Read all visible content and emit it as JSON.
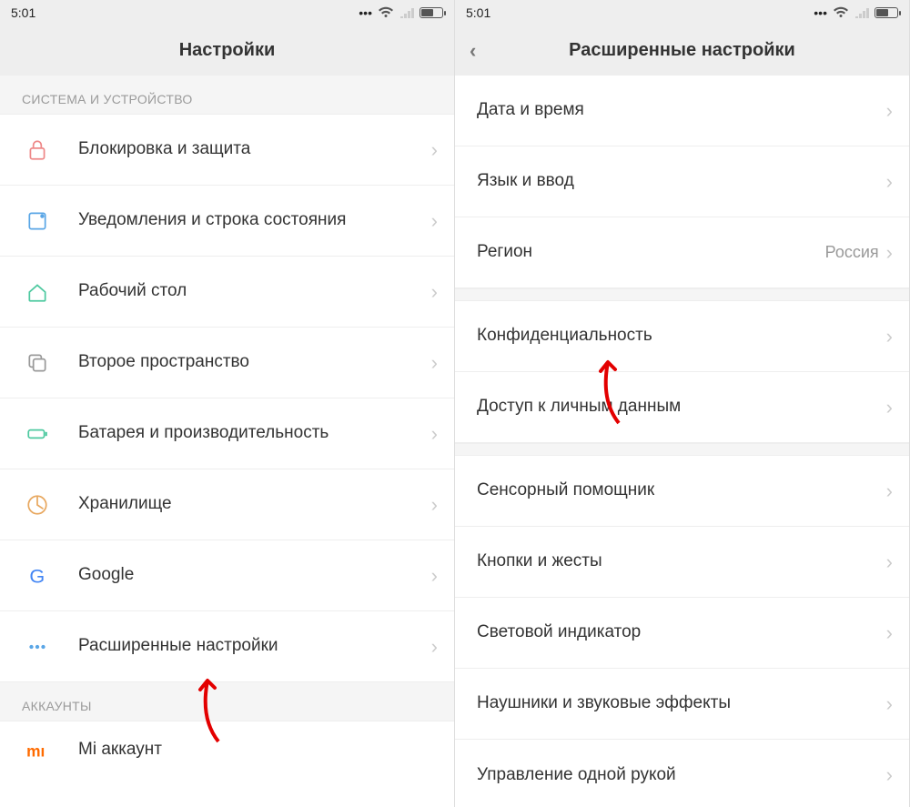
{
  "status": {
    "time": "5:01"
  },
  "left": {
    "title": "Настройки",
    "section_system": "СИСТЕМА И УСТРОЙСТВО",
    "items": [
      {
        "label": "Блокировка и защита"
      },
      {
        "label": "Уведомления и строка состояния"
      },
      {
        "label": "Рабочий стол"
      },
      {
        "label": "Второе пространство"
      },
      {
        "label": "Батарея и производительность"
      },
      {
        "label": "Хранилище"
      },
      {
        "label": "Google"
      },
      {
        "label": "Расширенные настройки"
      }
    ],
    "section_accounts": "АККАУНТЫ",
    "mi_account": "Mi аккаунт"
  },
  "right": {
    "title": "Расширенные настройки",
    "items": [
      {
        "label": "Дата и время"
      },
      {
        "label": "Язык и ввод"
      },
      {
        "label": "Регион",
        "value": "Россия"
      },
      {
        "label": "Конфиденциальность"
      },
      {
        "label": "Доступ к личным данным"
      },
      {
        "label": "Сенсорный помощник"
      },
      {
        "label": "Кнопки и жесты"
      },
      {
        "label": "Световой индикатор"
      },
      {
        "label": "Наушники и звуковые эффекты"
      },
      {
        "label": "Управление одной рукой"
      }
    ]
  }
}
